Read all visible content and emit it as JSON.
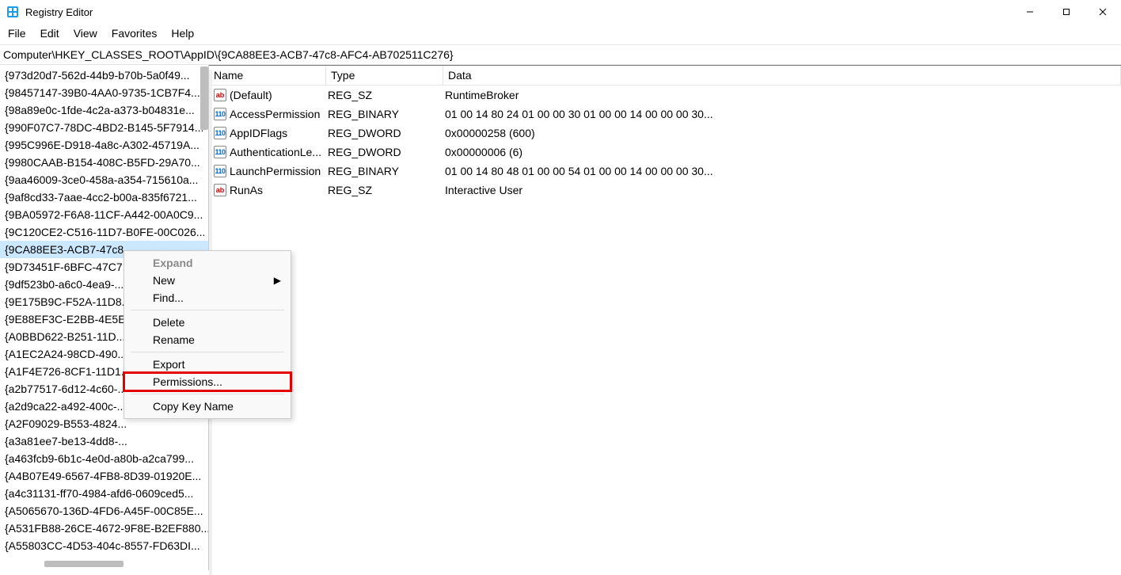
{
  "window": {
    "title": "Registry Editor"
  },
  "menubar": [
    "File",
    "Edit",
    "View",
    "Favorites",
    "Help"
  ],
  "addressbar": {
    "path": "Computer\\HKEY_CLASSES_ROOT\\AppID\\{9CA88EE3-ACB7-47c8-AFC4-AB702511C276}"
  },
  "tree": {
    "items": [
      "{973d20d7-562d-44b9-b70b-5a0f49...",
      "{98457147-39B0-4AA0-9735-1CB7F4...",
      "{98a89e0c-1fde-4c2a-a373-b04831e...",
      "{990F07C7-78DC-4BD2-B145-5F7914...",
      "{995C996E-D918-4a8c-A302-45719A...",
      "{9980CAAB-B154-408C-B5FD-29A70...",
      "{9aa46009-3ce0-458a-a354-715610a...",
      "{9af8cd33-7aae-4cc2-b00a-835f6721...",
      "{9BA05972-F6A8-11CF-A442-00A0C9...",
      "{9C120CE2-C516-11D7-B0FE-00C026...",
      "{9CA88EE3-ACB7-47c8...",
      "{9D73451F-6BFC-47C7...",
      "{9df523b0-a6c0-4ea9-...",
      "{9E175B9C-F52A-11D8...",
      "{9E88EF3C-E2BB-4E5E...",
      "{A0BBD622-B251-11D...",
      "{A1EC2A24-98CD-490...",
      "{A1F4E726-8CF1-11D1...",
      "{a2b77517-6d12-4c60-...",
      "{a2d9ca22-a492-400c-...",
      "{A2F09029-B553-4824...",
      "{a3a81ee7-be13-4dd8-...",
      "{a463fcb9-6b1c-4e0d-a80b-a2ca799...",
      "{A4B07E49-6567-4FB8-8D39-01920E...",
      "{a4c31131-ff70-4984-afd6-0609ced5...",
      "{A5065670-136D-4FD6-A45F-00C85E...",
      "{A531FB88-26CE-4672-9F8E-B2EF880...",
      "{A55803CC-4D53-404c-8557-FD63DI..."
    ],
    "selected_index": 10
  },
  "values": {
    "columns": [
      "Name",
      "Type",
      "Data"
    ],
    "rows": [
      {
        "icon": "sz",
        "name": "(Default)",
        "type": "REG_SZ",
        "data": "RuntimeBroker"
      },
      {
        "icon": "bin",
        "name": "AccessPermission",
        "type": "REG_BINARY",
        "data": "01 00 14 80 24 01 00 00 30 01 00 00 14 00 00 00 30..."
      },
      {
        "icon": "bin",
        "name": "AppIDFlags",
        "type": "REG_DWORD",
        "data": "0x00000258 (600)"
      },
      {
        "icon": "bin",
        "name": "AuthenticationLe...",
        "type": "REG_DWORD",
        "data": "0x00000006 (6)"
      },
      {
        "icon": "bin",
        "name": "LaunchPermission",
        "type": "REG_BINARY",
        "data": "01 00 14 80 48 01 00 00 54 01 00 00 14 00 00 00 30..."
      },
      {
        "icon": "sz",
        "name": "RunAs",
        "type": "REG_SZ",
        "data": "Interactive User"
      }
    ]
  },
  "context_menu": {
    "items": [
      {
        "label": "Expand",
        "disabled": true
      },
      {
        "label": "New",
        "submenu": true
      },
      {
        "label": "Find..."
      },
      {
        "sep": true
      },
      {
        "label": "Delete"
      },
      {
        "label": "Rename"
      },
      {
        "sep": true
      },
      {
        "label": "Export"
      },
      {
        "label": "Permissions...",
        "highlighted": true
      },
      {
        "sep": true
      },
      {
        "label": "Copy Key Name"
      }
    ]
  }
}
